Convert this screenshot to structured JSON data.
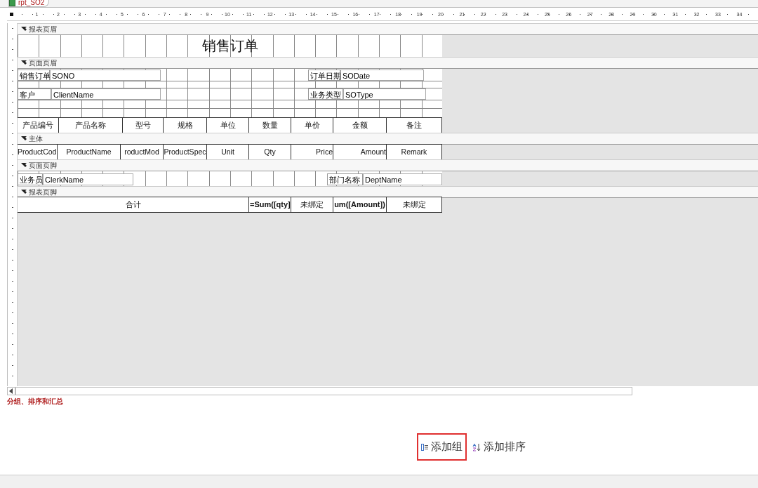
{
  "tab": {
    "title": "rpt_SO2",
    "selected": true
  },
  "ruler": [
    "1",
    "2",
    "3",
    "4",
    "5",
    "6",
    "7",
    "8",
    "9",
    "10",
    "11",
    "12",
    "13",
    "14",
    "15",
    "16",
    "17",
    "18",
    "19",
    "20",
    "21",
    "22",
    "23",
    "24",
    "25",
    "26",
    "27",
    "28",
    "29",
    "30",
    "31",
    "32",
    "33",
    "34"
  ],
  "sections": [
    {
      "title": "报表页眉",
      "kind": "report_header",
      "heading": "销售订单"
    },
    {
      "title": "页面页眉",
      "kind": "page_header",
      "fields": [
        {
          "label": "销售订单",
          "value": "SONO"
        },
        {
          "label": "订单日期",
          "value": "SODate"
        },
        {
          "label": "客户",
          "value": "ClientName"
        },
        {
          "label": "业务类型",
          "value": "SOType"
        }
      ],
      "columns": [
        "产品编号",
        "产品名称",
        "型号",
        "规格",
        "单位",
        "数量",
        "单价",
        "金额",
        "备注"
      ]
    },
    {
      "title": "主体",
      "kind": "detail",
      "cells": [
        "ProductCod",
        "ProductName",
        "roductMod",
        "ProductSpec",
        "Unit",
        "Qty",
        "Price",
        "Amount",
        "Remark"
      ]
    },
    {
      "title": "页面页脚",
      "kind": "page_footer",
      "fields": [
        {
          "label": "业务员",
          "value": "ClerkName"
        },
        {
          "label": "部门名称",
          "value": "DeptName"
        }
      ]
    },
    {
      "title": "报表页脚",
      "kind": "report_footer",
      "cells": [
        "合计",
        "=Sum([qty]",
        "未绑定",
        "um([Amount])",
        "未绑定"
      ]
    }
  ],
  "group_panel": {
    "title": "分组、排序和汇总",
    "buttons": [
      {
        "label": "添加组",
        "kind": "group",
        "highlighted": true
      },
      {
        "label": "添加排序",
        "kind": "sort",
        "highlighted": false
      }
    ]
  }
}
